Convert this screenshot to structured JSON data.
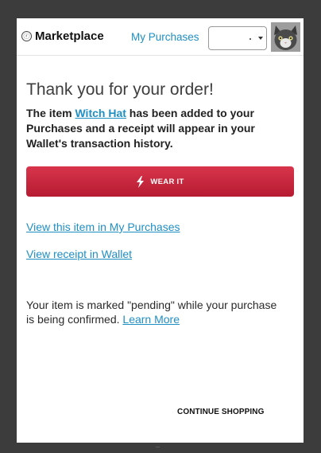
{
  "header": {
    "brand_icon": "ⓡ",
    "brand": "Marketplace",
    "nav_link": "My Purchases",
    "account_select_value": "."
  },
  "confirmation": {
    "title": "Thank you for your order!",
    "message_prefix": "The item",
    "item_name": "Witch Hat",
    "message_suffix": "has been added to your Purchases and a receipt will appear in your Wallet's transaction history.",
    "wear_button": "WEAR IT",
    "view_item_link": "View this item in My Purchases",
    "view_receipt_link": "View receipt in Wallet",
    "pending_text": "Your item is marked \"pending\" while your purchase is being confirmed.",
    "learn_more": "Learn More",
    "continue_button": "CONTINUE SHOPPING"
  },
  "colors": {
    "accent": "#1f8fc4",
    "button": "#c8283f",
    "background": "#3c3c3c"
  }
}
